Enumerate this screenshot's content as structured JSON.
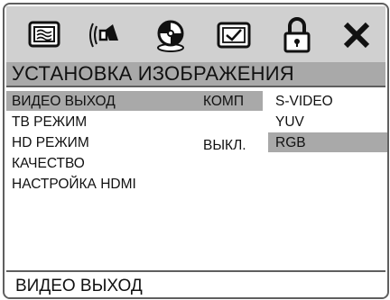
{
  "icons": [
    "monitor-icon",
    "speaker-icon",
    "disc-settings-icon",
    "video-check-icon",
    "lock-icon",
    "close-icon"
  ],
  "section_title": "УСТАНОВКА ИЗОБРАЖЕНИЯ",
  "menu": {
    "items": [
      {
        "label": "ВИДЕО ВЫХОД",
        "value": "КОМП",
        "selected": true
      },
      {
        "label": "ТВ РЕЖИМ",
        "value": ""
      },
      {
        "label": "HD РЕЖИМ",
        "value": "ВЫКЛ."
      },
      {
        "label": "КАЧЕСТВО",
        "value": ""
      },
      {
        "label": "НАСТРОЙКА HDMI",
        "value": ""
      }
    ]
  },
  "options": [
    {
      "label": "S-VIDEO"
    },
    {
      "label": "YUV"
    },
    {
      "label": "RGB",
      "selected": true
    }
  ],
  "status_text": "ВИДЕО ВЫХОД",
  "colors": {
    "bar": "#d0d0d0",
    "highlight": "#a9a9a9",
    "border": "#5f5f5f"
  }
}
